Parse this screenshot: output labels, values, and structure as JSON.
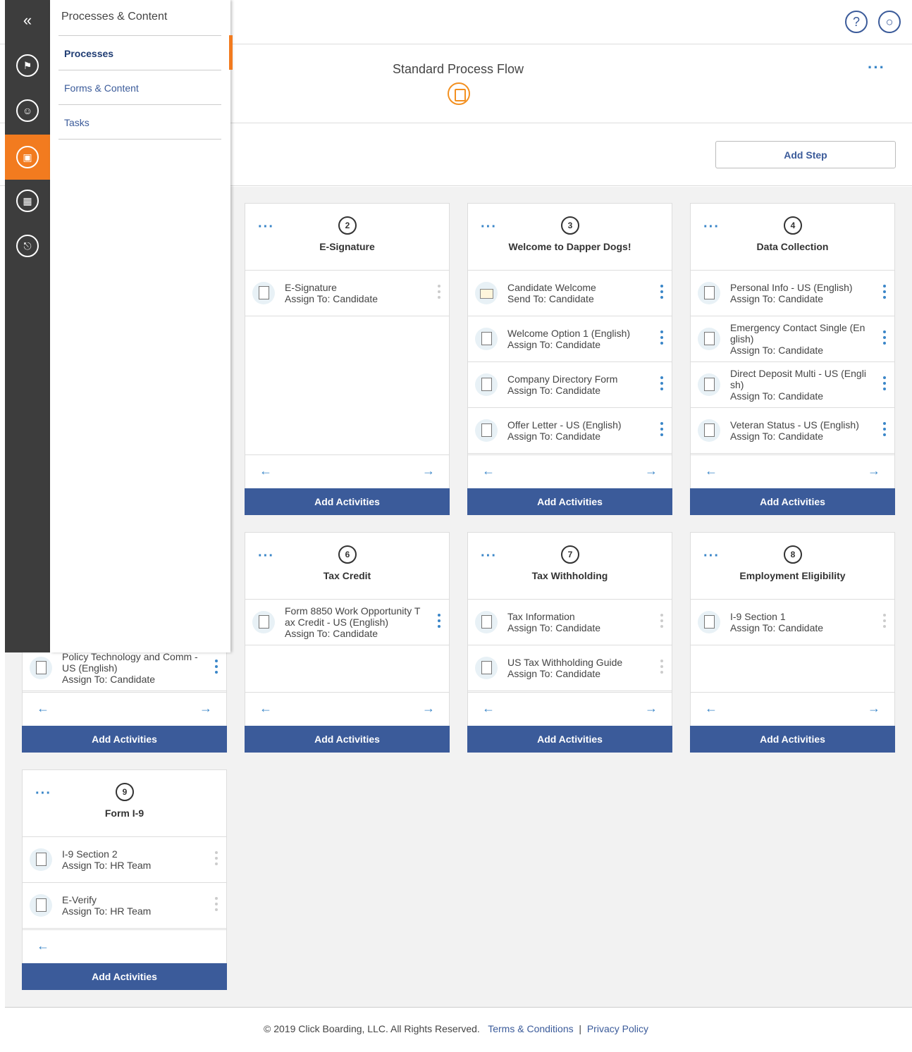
{
  "header": {
    "title": "Standard Process Flow",
    "help_icon": "question-icon",
    "account_icon": "lock-icon",
    "more_icon": "more-dots-icon"
  },
  "toolbar": {
    "add_step_label": "Add Step"
  },
  "nav": {
    "collapse_glyph": "«",
    "items": [
      {
        "icon": "flag-icon"
      },
      {
        "icon": "add-user-icon"
      },
      {
        "icon": "clipboard-icon",
        "active": true
      },
      {
        "icon": "building-icon"
      },
      {
        "icon": "plug-icon"
      }
    ]
  },
  "flyout": {
    "title": "Processes & Content",
    "items": [
      {
        "label": "Processes",
        "selected": true
      },
      {
        "label": "Forms & Content"
      },
      {
        "label": "Tasks"
      }
    ]
  },
  "steps": [
    {
      "number": "2",
      "title": "E-Signature",
      "activities": [
        {
          "name": "E-Signature",
          "assign": "Assign To: Candidate"
        }
      ],
      "add_label": "Add Activities"
    },
    {
      "number": "3",
      "title": "Welcome to Dapper Dogs!",
      "activities": [
        {
          "name": "Candidate Welcome",
          "assign": "Send To: Candidate"
        },
        {
          "name": "Welcome Option 1 (English)",
          "assign": "Assign To: Candidate"
        },
        {
          "name": "Company Directory Form",
          "assign": "Assign To: Candidate"
        },
        {
          "name": "Offer Letter - US (English)",
          "assign": "Assign To: Candidate"
        }
      ],
      "add_label": "Add Activities"
    },
    {
      "number": "4",
      "title": "Data Collection",
      "activities": [
        {
          "name": "Personal Info - US (English)",
          "assign": "Assign To: Candidate"
        },
        {
          "name": "Emergency Contact Single (En glish)",
          "assign": "Assign To: Candidate"
        },
        {
          "name": "Direct Deposit Multi - US (Engli sh)",
          "assign": "Assign To: Candidate"
        },
        {
          "name": "Veteran Status - US (English)",
          "assign": "Assign To: Candidate"
        }
      ],
      "add_label": "Add Activities"
    },
    {
      "partial_activity": {
        "name": "Policy Technology and Comm - US (English)",
        "assign": "Assign To: Candidate"
      },
      "add_label": "Add Activities"
    },
    {
      "number": "6",
      "title": "Tax Credit",
      "activities": [
        {
          "name": "Form 8850 Work Opportunity T ax Credit - US (English)",
          "assign": "Assign To: Candidate"
        }
      ],
      "add_label": "Add Activities"
    },
    {
      "number": "7",
      "title": "Tax Withholding",
      "activities": [
        {
          "name": "Tax Information",
          "assign": "Assign To: Candidate"
        },
        {
          "name": "US Tax Withholding Guide",
          "assign": "Assign To: Candidate"
        }
      ],
      "add_label": "Add Activities"
    },
    {
      "number": "8",
      "title": "Employment Eligibility",
      "activities": [
        {
          "name": "I-9 Section 1",
          "assign": "Assign To: Candidate"
        }
      ],
      "add_label": "Add Activities"
    },
    {
      "number": "9",
      "title": "Form I-9",
      "activities": [
        {
          "name": "I-9 Section 2",
          "assign": "Assign To: HR Team"
        },
        {
          "name": "E-Verify",
          "assign": "Assign To: HR Team"
        }
      ],
      "add_label": "Add Activities"
    }
  ],
  "footer": {
    "copyright": "© 2019 Click Boarding, LLC. All Rights Reserved.",
    "terms": "Terms & Conditions",
    "separator": "|",
    "privacy": "Privacy Policy"
  }
}
